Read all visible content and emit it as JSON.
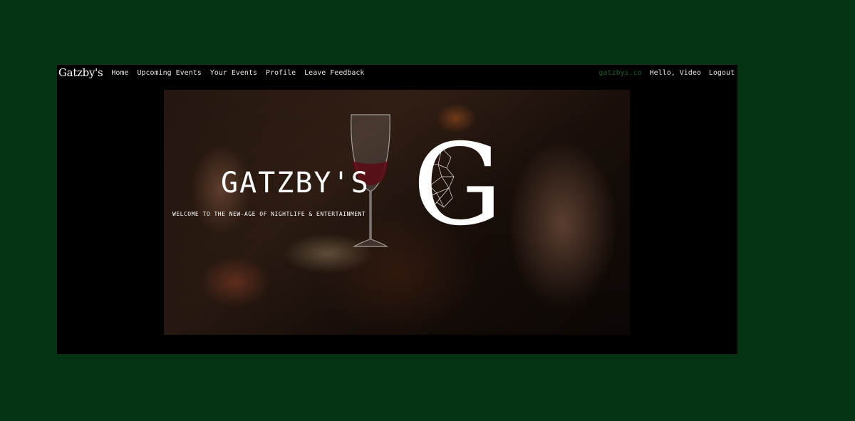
{
  "navbar": {
    "brand": "Gatzby's",
    "links": [
      "Home",
      "Upcoming Events",
      "Your Events",
      "Profile",
      "Leave Feedback"
    ],
    "site_link": "gatzbys.co",
    "greeting": "Hello, Video",
    "logout": "Logout"
  },
  "hero": {
    "title": "GATZBY'S",
    "subtitle": "WELCOME TO THE NEW-AGE OF NIGHTLIFE & ENTERTAINMENT",
    "logo_letter": "G"
  },
  "colors": {
    "page_background": "#063314",
    "frame_background": "#000000",
    "site_link": "#1f5c2e"
  }
}
